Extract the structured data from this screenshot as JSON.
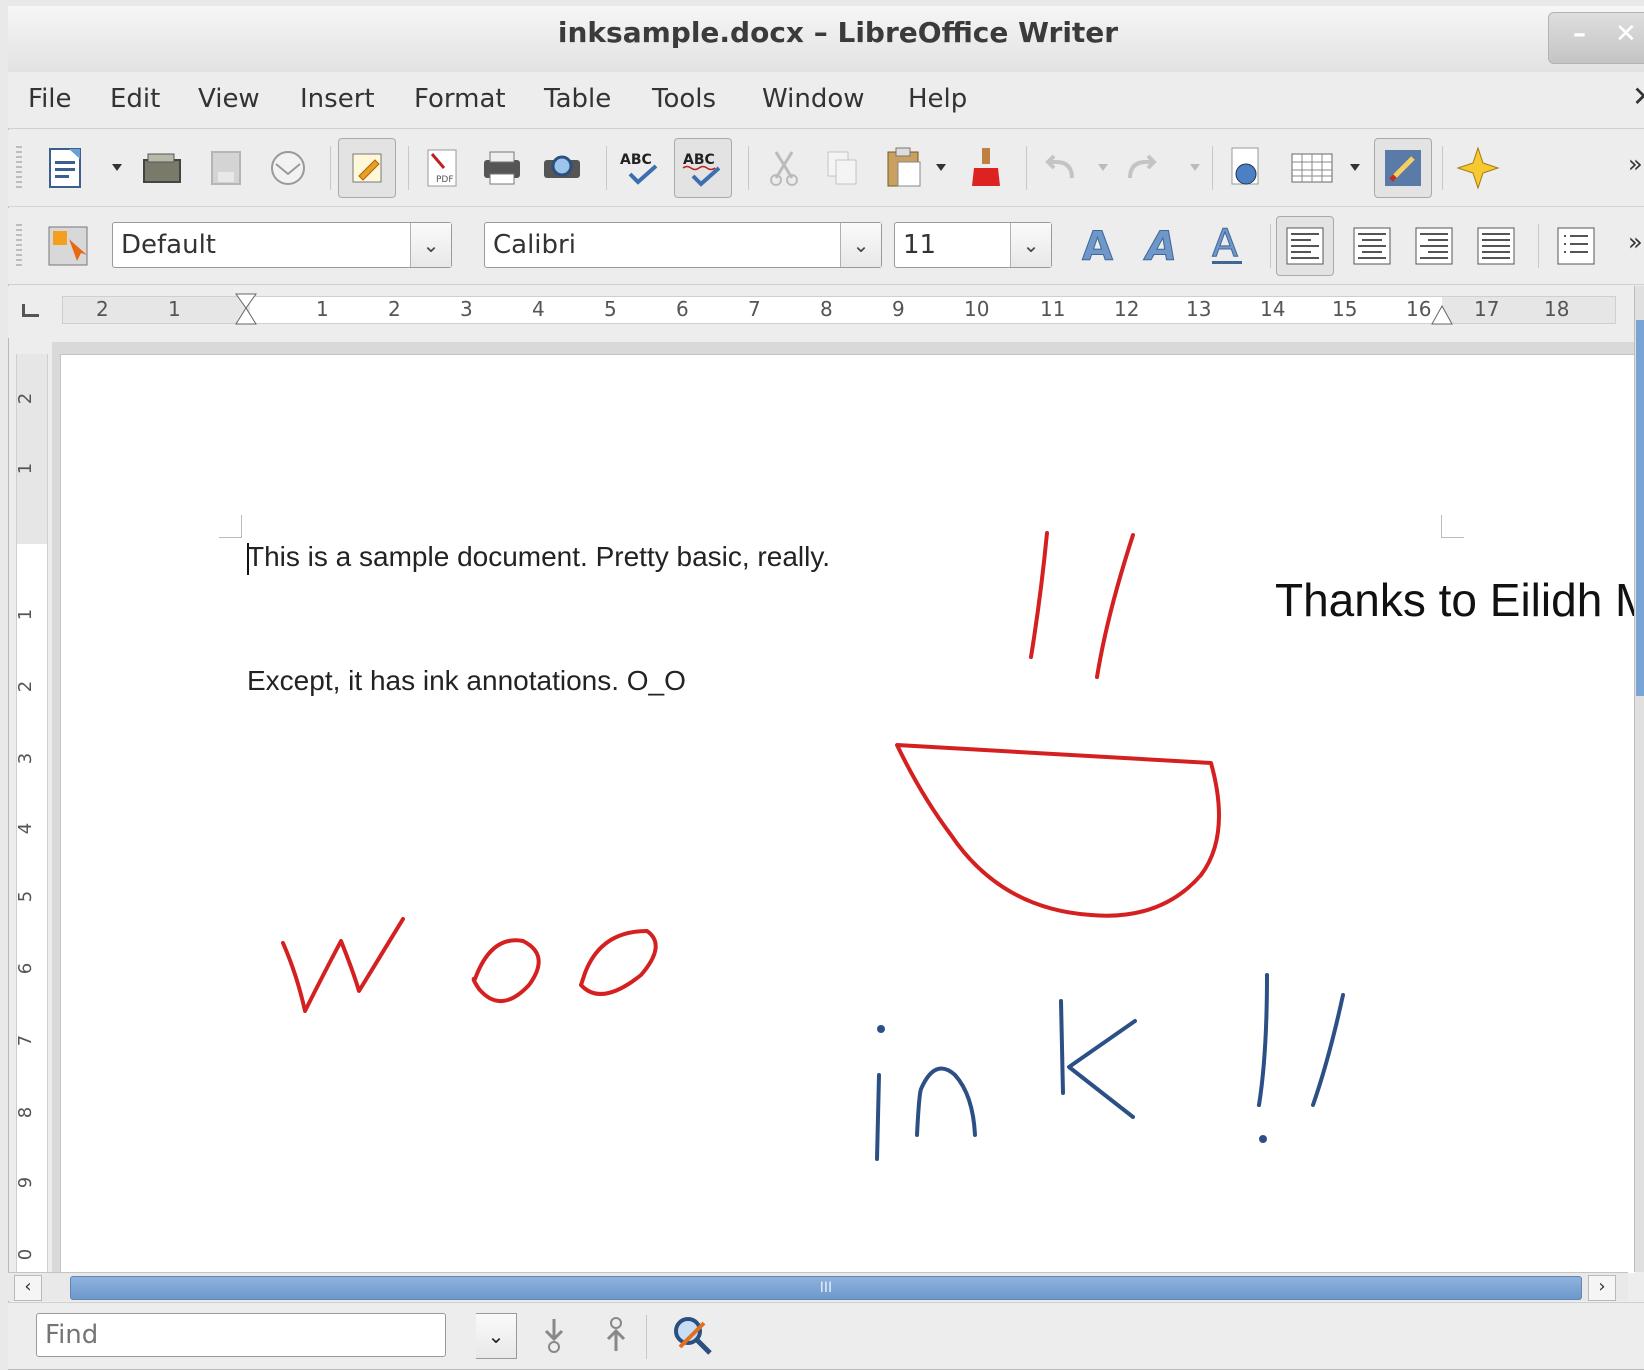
{
  "window": {
    "title": "inksample.docx – LibreOffice Writer",
    "min_label": "–",
    "close_label": "✕"
  },
  "menu": {
    "items": [
      {
        "label": "File"
      },
      {
        "label": "Edit"
      },
      {
        "label": "View"
      },
      {
        "label": "Insert"
      },
      {
        "label": "Format"
      },
      {
        "label": "Table"
      },
      {
        "label": "Tools"
      },
      {
        "label": "Window"
      },
      {
        "label": "Help"
      }
    ],
    "close_label": "✕"
  },
  "toolbar": {
    "overflow_label": "»"
  },
  "formatting": {
    "style_value": "Default",
    "font_value": "Calibri",
    "size_value": "11",
    "overflow_label": "»"
  },
  "ruler": {
    "labels": [
      "2",
      "1",
      "1",
      "2",
      "3",
      "4",
      "5",
      "6",
      "7",
      "8",
      "9",
      "10",
      "11",
      "12",
      "13",
      "14",
      "15",
      "16",
      "17",
      "18"
    ],
    "vlabels": [
      "2",
      "1",
      "1",
      "2",
      "3",
      "4",
      "5",
      "6",
      "7",
      "8",
      "9",
      "0"
    ]
  },
  "document": {
    "line1": "This is a sample document.  Pretty basic, really.",
    "line2": "Except, it has ink annotations.  O_O",
    "side_note": "Thanks to Eilidh M",
    "ink": {
      "red_color": "#d42020",
      "blue_color": "#2c4f86",
      "red_words": "woo",
      "blue_words": "ink !!"
    }
  },
  "scroll": {
    "left_arrow": "‹",
    "right_arrow": "›",
    "thumb_grip": "III"
  },
  "findbar": {
    "placeholder": "Find"
  }
}
